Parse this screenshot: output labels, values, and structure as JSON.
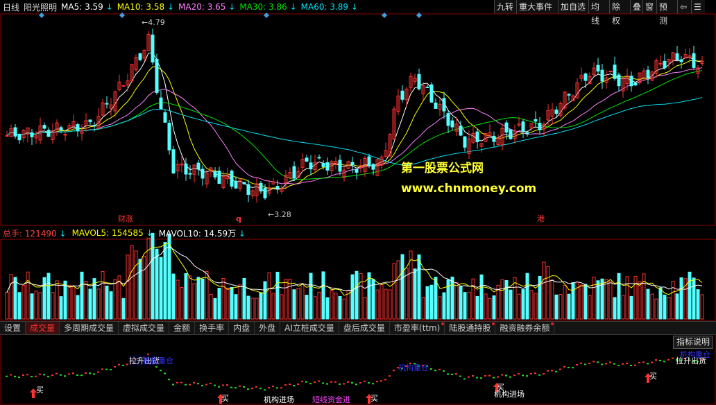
{
  "main_legend": {
    "period": "日线",
    "formula": "阳光照明",
    "ma5": "MA5: 3.59",
    "ma10": "MA10: 3.58",
    "ma20": "MA20: 3.65",
    "ma30": "MA30: 3.86",
    "ma60": "MA60: 3.89",
    "arrow": "↓"
  },
  "toolbar": [
    "九转",
    "重大事件",
    "加自选",
    "均线",
    "除权",
    "叠",
    "窗",
    "预测",
    "⇦",
    "☰"
  ],
  "price_annotations": {
    "high": "4.79",
    "low": "3.28",
    "marker_cai": "财",
    "marker_zhang": "涨",
    "marker_q": "q",
    "marker_gang": "港"
  },
  "watermark": {
    "line1": "第一股票公式网",
    "line2": "www.chnmoney.com"
  },
  "vol_legend": {
    "total": "总手: 121490",
    "mavol5": "MAVOL5: 154585",
    "mavol10": "MAVOL10: 14.59万",
    "arrow": "↓"
  },
  "tabs": [
    {
      "label": "设置",
      "active": false,
      "dot": false
    },
    {
      "label": "成交量",
      "active": true,
      "dot": false
    },
    {
      "label": "多周期成交量",
      "active": false,
      "dot": false
    },
    {
      "label": "虚拟成交量",
      "active": false,
      "dot": false
    },
    {
      "label": "金额",
      "active": false,
      "dot": false
    },
    {
      "label": "换手率",
      "active": false,
      "dot": false
    },
    {
      "label": "内盘",
      "active": false,
      "dot": false
    },
    {
      "label": "外盘",
      "active": false,
      "dot": false
    },
    {
      "label": "AI立桩成交量",
      "active": false,
      "dot": false
    },
    {
      "label": "盘后成交量",
      "active": false,
      "dot": false
    },
    {
      "label": "市盈率(ttm)",
      "active": false,
      "dot": true
    },
    {
      "label": "陆股通持股",
      "active": false,
      "dot": true
    },
    {
      "label": "融资融券余额",
      "active": false,
      "dot": true
    }
  ],
  "indicator_button": "指标说明",
  "indicator_labels": {
    "buy": "买",
    "pull_out": "拉升出货",
    "inst_hold": "机构重仓",
    "inst_enter": "机构进场",
    "main_force": "短线资金进"
  },
  "colors": {
    "up": "#ff3232",
    "down": "#54ffff",
    "ma5": "#ffffff",
    "ma10": "#ffff00",
    "ma20": "#ff80ff",
    "ma30": "#00e600",
    "ma60": "#02e2f4",
    "grid": "#8b0000"
  }
}
